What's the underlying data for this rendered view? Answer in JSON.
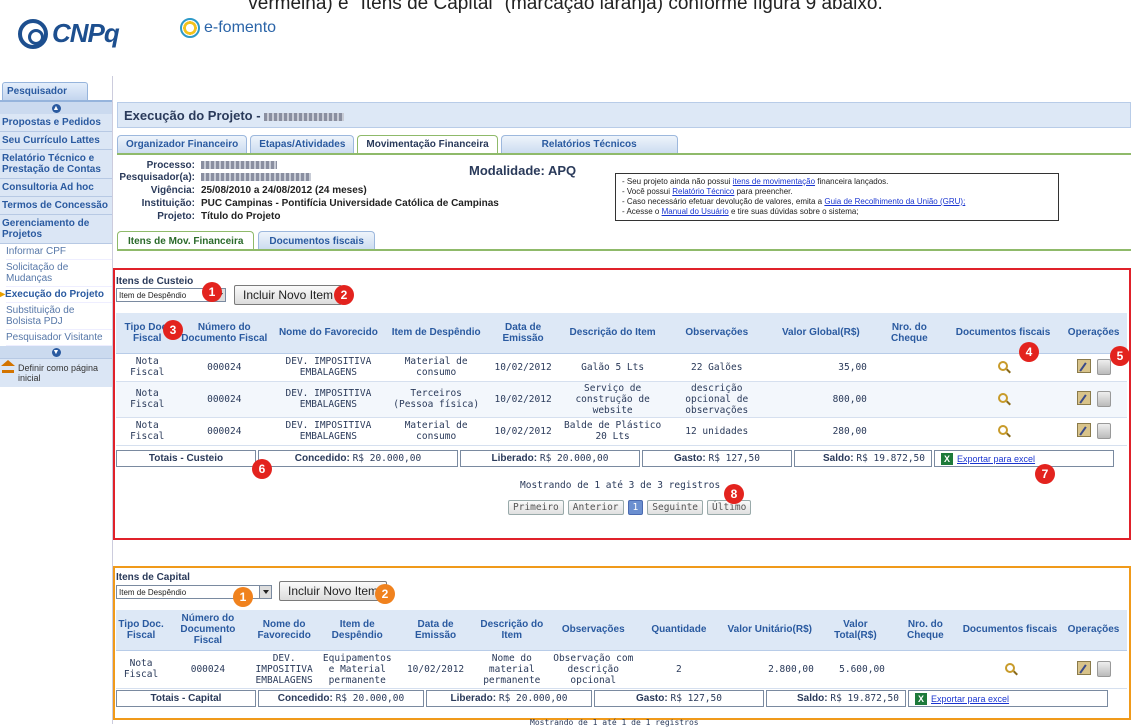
{
  "caption": "vermelha) e \"Itens de Capital\" (marcação laranja) conforme figura 9 abaixo.",
  "header": {
    "logo": "CNPq",
    "app_name": "e-fomento"
  },
  "sidebar": {
    "tab": "Pesquisador",
    "items": [
      "Propostas e Pedidos",
      "Seu Currículo Lattes",
      "Relatório Técnico e Prestação de Contas",
      "Consultoria Ad hoc",
      "Termos de Concessão",
      "Gerenciamento de Projetos"
    ],
    "subitems": [
      "Informar CPF",
      "Solicitação de Mudanças",
      "Execução do Projeto",
      "Substituição de Bolsista PDJ",
      "Pesquisador Visitante"
    ],
    "home_label": "Definir como página inicial"
  },
  "main": {
    "title": "Execução do Projeto -",
    "tabs": [
      "Organizador Financeiro",
      "Etapas/Atividades",
      "Movimentação Financeira",
      "Relatórios Técnicos"
    ],
    "info": {
      "processo_label": "Processo:",
      "pesquisador_label": "Pesquisador(a):",
      "vigencia_label": "Vigência:",
      "vigencia_value": "25/08/2010 a 24/08/2012 (24 meses)",
      "instituicao_label": "Instituição:",
      "instituicao_value": "PUC Campinas - Pontifícia Universidade Católica de Campinas",
      "projeto_label": "Projeto:",
      "projeto_value": "Título do Projeto",
      "modalidade_label": "Modalidade:",
      "modalidade_value": "APQ"
    },
    "notice": {
      "l1a": "- Seu projeto ainda não possui ",
      "l1link": "itens de movimentação",
      "l1b": " financeira lançados.",
      "l2a": "- Você possui ",
      "l2link": "Relatório Técnico",
      "l2b": " para preencher.",
      "l3a": "- Caso necessário efetuar devolução de valores, emita a ",
      "l3link": "Guia de Recolhimento da União (GRU);",
      "l4a": "- Acesse o ",
      "l4link": "Manual do Usuário",
      "l4b": " e tire suas dúvidas sobre o sistema;"
    },
    "sub_tabs": [
      "Itens de Mov. Financeira",
      "Documentos fiscais"
    ]
  },
  "custeio": {
    "title": "Itens de Custeio",
    "select_value": "Item de Despêndio",
    "add_button": "Incluir Novo Item",
    "columns": [
      "Tipo Doc. Fiscal",
      "Número do Documento Fiscal",
      "Nome do Favorecido",
      "Item de Despêndio",
      "Data de Emissão",
      "Descrição do Item",
      "Observações",
      "Valor Global(R$)",
      "Nro. do Cheque",
      "Documentos fiscais",
      "Operações"
    ],
    "rows": [
      {
        "tipo": "Nota Fiscal",
        "num": "000024",
        "fav": "DEV. IMPOSITIVA EMBALAGENS",
        "item": "Material de consumo",
        "data": "10/02/2012",
        "desc": "Galão 5 Lts",
        "obs": "22 Galões",
        "valor": "35,00",
        "cheque": ""
      },
      {
        "tipo": "Nota Fiscal",
        "num": "000024",
        "fav": "DEV. IMPOSITIVA EMBALAGENS",
        "item": "Terceiros (Pessoa física)",
        "data": "10/02/2012",
        "desc": "Serviço de construção de website",
        "obs": "descrição opcional de observações",
        "valor": "800,00",
        "cheque": ""
      },
      {
        "tipo": "Nota Fiscal",
        "num": "000024",
        "fav": "DEV. IMPOSITIVA EMBALAGENS",
        "item": "Material de consumo",
        "data": "10/02/2012",
        "desc": "Balde de Plástico 20 Lts",
        "obs": "12 unidades",
        "valor": "280,00",
        "cheque": ""
      }
    ],
    "totals_label": "Totais - Custeio",
    "concedido_label": "Concedido:",
    "concedido": "R$ 20.000,00",
    "liberado_label": "Liberado:",
    "liberado": "R$ 20.000,00",
    "gasto_label": "Gasto:",
    "gasto": "R$ 127,50",
    "saldo_label": "Saldo:",
    "saldo": "R$ 19.872,50",
    "export": "Exportar para excel",
    "pager_text": "Mostrando de 1 até 3 de 3 registros",
    "pager": {
      "first": "Primeiro",
      "prev": "Anterior",
      "page": "1",
      "next": "Seguinte",
      "last": "Último"
    }
  },
  "capital": {
    "title": "Itens de Capital",
    "select_value": "Item de Despêndio",
    "add_button": "Incluir Novo Item",
    "columns": [
      "Tipo Doc. Fiscal",
      "Número do Documento Fiscal",
      "Nome do Favorecido",
      "Item de Despêndio",
      "Data de Emissão",
      "Descrição do Item",
      "Observações",
      "Quantidade",
      "Valor Unitário(R$)",
      "Valor Total(R$)",
      "Nro. do Cheque",
      "Documentos fiscais",
      "Operações"
    ],
    "rows": [
      {
        "tipo": "Nota Fiscal",
        "num": "000024",
        "fav": "DEV. IMPOSITIVA EMBALAGENS",
        "item": "Equipamentos e Material permanente",
        "data": "10/02/2012",
        "desc": "Nome do material permanente",
        "obs": "Observação com descrição opcional",
        "qtd": "2",
        "unit": "2.800,00",
        "total": "5.600,00",
        "cheque": ""
      }
    ],
    "totals_label": "Totais - Capital",
    "concedido_label": "Concedido:",
    "concedido": "R$ 20.000,00",
    "liberado_label": "Liberado:",
    "liberado": "R$ 20.000,00",
    "gasto_label": "Gasto:",
    "gasto": "R$ 127,50",
    "saldo_label": "Saldo:",
    "saldo": "R$ 19.872,50",
    "export": "Exportar para excel",
    "pager_text": "Mostrando de 1 até 1 de 1 registros"
  },
  "badges": {
    "custeio": [
      "1",
      "2",
      "3",
      "4",
      "5",
      "6",
      "7",
      "8"
    ],
    "capital": [
      "1",
      "2"
    ]
  },
  "colors": {
    "red_box": "#e0212a",
    "orange_box": "#f09a1a",
    "badge_red": "#e3231e",
    "badge_orange": "#f0821e"
  }
}
